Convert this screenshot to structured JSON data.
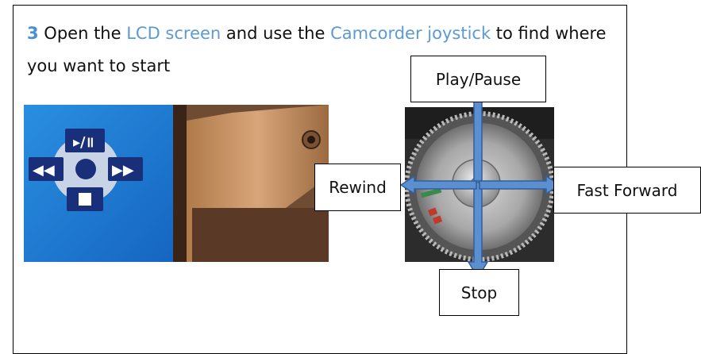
{
  "instruction": {
    "step_number": "3",
    "text_1": " Open the ",
    "term_1": "LCD screen",
    "text_2": " and use the ",
    "term_2": "Camcorder joystick",
    "text_3": " to find where you want to start"
  },
  "labels": {
    "play_pause": "Play/Pause",
    "rewind": "Rewind",
    "fast_forward": "Fast Forward",
    "stop": "Stop"
  },
  "colors": {
    "accent_text": "#5c9ad2",
    "arrow_fill": "#5b8fcf",
    "lcd_blue": "#1f7fd6",
    "lcd_navy": "#1a2f7a"
  }
}
